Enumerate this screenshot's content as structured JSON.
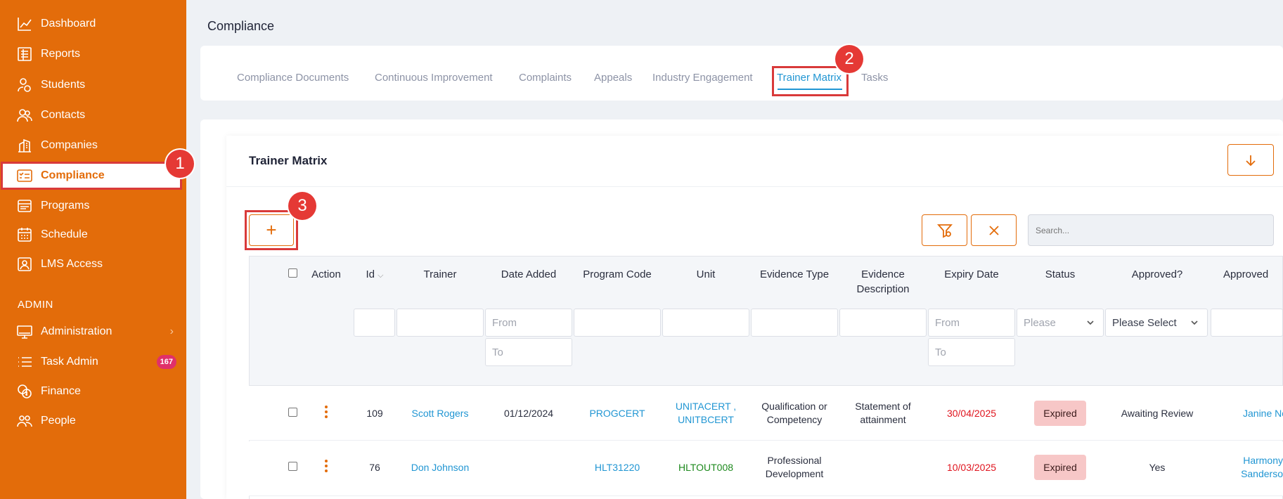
{
  "sidebar": {
    "items": [
      {
        "label": "Dashboard",
        "icon": "chart-line-icon"
      },
      {
        "label": "Reports",
        "icon": "report-icon"
      },
      {
        "label": "Students",
        "icon": "students-icon"
      },
      {
        "label": "Contacts",
        "icon": "contacts-icon"
      },
      {
        "label": "Companies",
        "icon": "buildings-icon"
      },
      {
        "label": "Compliance",
        "icon": "checklist-icon",
        "active": true
      },
      {
        "label": "Programs",
        "icon": "programs-icon"
      },
      {
        "label": "Schedule",
        "icon": "calendar-icon"
      },
      {
        "label": "LMS Access",
        "icon": "lms-icon"
      }
    ],
    "admin_label": "ADMIN",
    "admin_items": [
      {
        "label": "Administration",
        "icon": "monitor-icon"
      },
      {
        "label": "Task Admin",
        "icon": "list-icon",
        "badge": "167"
      },
      {
        "label": "Finance",
        "icon": "coins-icon"
      },
      {
        "label": "People",
        "icon": "people-icon"
      }
    ]
  },
  "header": {
    "title": "Compliance"
  },
  "tabs": [
    "Compliance Documents",
    "Continuous Improvement",
    "Complaints",
    "Appeals",
    "Industry Engagement",
    "Trainer Matrix",
    "Tasks"
  ],
  "active_tab": "Trainer Matrix",
  "callouts": [
    "1",
    "2",
    "3"
  ],
  "section": {
    "title": "Trainer Matrix"
  },
  "toolbar": {
    "add_label": "+",
    "search_placeholder": "Search..."
  },
  "table": {
    "columns": [
      "Action",
      "Id",
      "Trainer",
      "Date Added",
      "Program Code",
      "Unit",
      "Evidence Type",
      "Evidence\nDescription",
      "Expiry Date",
      "Status",
      "Approved?",
      "Approved"
    ],
    "filters": {
      "date_added_from": "From",
      "date_added_to": "To",
      "expiry_from": "From",
      "expiry_to": "To",
      "status": "Please",
      "approved": "Please Select"
    },
    "rows": [
      {
        "id": "109",
        "trainer": "Scott Rogers",
        "date_added": "01/12/2024",
        "program_code": "PROGCERT",
        "unit": "UNITACERT ,\nUNITBCERT",
        "evidence_type": "Qualification or\nCompetency",
        "evidence_description": "Statement of\nattainment",
        "expiry_date": "30/04/2025",
        "status": "Expired",
        "approved": "Awaiting Review",
        "approved_by": "Janine Notc"
      },
      {
        "id": "76",
        "trainer": "Don Johnson",
        "date_added": "",
        "program_code": "HLT31220",
        "unit": "HLTOUT008",
        "evidence_type": "Professional\nDevelopment",
        "evidence_description": "",
        "expiry_date": "10/03/2025",
        "status": "Expired",
        "approved": "Yes",
        "approved_by": "Harmony\nSanderso"
      }
    ]
  },
  "colors": {
    "brand": "#e36c0a",
    "link": "#2196d3",
    "highlight": "#d93a3a",
    "expired_bg": "#f7c7c7"
  }
}
